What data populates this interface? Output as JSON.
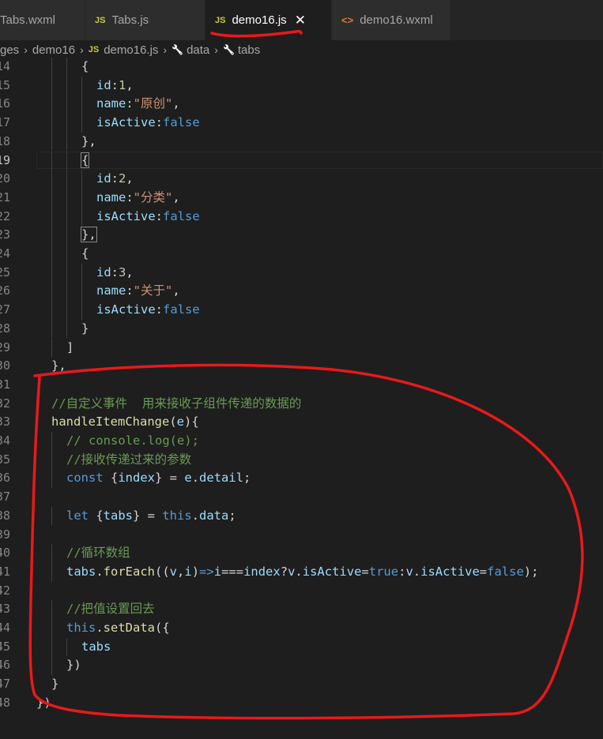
{
  "tabs": [
    {
      "label": "Tabs.wxml",
      "icon": "xml-file-icon",
      "active": false
    },
    {
      "label": "Tabs.js",
      "icon": "js-file-icon",
      "active": false
    },
    {
      "label": "demo16.js",
      "icon": "js-file-icon",
      "active": true,
      "close": "✕"
    },
    {
      "label": "demo16.wxml",
      "icon": "xml-file-icon",
      "active": false
    }
  ],
  "breadcrumb": [
    "ges",
    "demo16",
    "demo16.js",
    "data",
    "tabs"
  ],
  "editor": {
    "current_line": 19,
    "lines": [
      {
        "n": "14",
        "indent": 3,
        "tokens": [
          [
            "{",
            "pun"
          ]
        ]
      },
      {
        "n": "15",
        "indent": 4,
        "tokens": [
          [
            "id",
            "prop"
          ],
          [
            ":",
            "pun"
          ],
          [
            "1",
            "num"
          ],
          [
            ",",
            "pun"
          ]
        ]
      },
      {
        "n": "16",
        "indent": 4,
        "tokens": [
          [
            "name",
            "prop"
          ],
          [
            ":",
            "pun"
          ],
          [
            "\"原创\"",
            "str"
          ],
          [
            ",",
            "pun"
          ]
        ]
      },
      {
        "n": "17",
        "indent": 4,
        "tokens": [
          [
            "isActive",
            "prop"
          ],
          [
            ":",
            "pun"
          ],
          [
            "false",
            "kw"
          ]
        ]
      },
      {
        "n": "18",
        "indent": 3,
        "tokens": [
          [
            "},",
            "pun"
          ]
        ]
      },
      {
        "n": "19",
        "indent": 3,
        "tokens": [
          [
            "{",
            "pun"
          ]
        ]
      },
      {
        "n": "20",
        "indent": 4,
        "tokens": [
          [
            "id",
            "prop"
          ],
          [
            ":",
            "pun"
          ],
          [
            "2",
            "num"
          ],
          [
            ",",
            "pun"
          ]
        ]
      },
      {
        "n": "21",
        "indent": 4,
        "tokens": [
          [
            "name",
            "prop"
          ],
          [
            ":",
            "pun"
          ],
          [
            "\"分类\"",
            "str"
          ],
          [
            ",",
            "pun"
          ]
        ]
      },
      {
        "n": "22",
        "indent": 4,
        "tokens": [
          [
            "isActive",
            "prop"
          ],
          [
            ":",
            "pun"
          ],
          [
            "false",
            "kw"
          ]
        ]
      },
      {
        "n": "23",
        "indent": 3,
        "tokens": [
          [
            "},",
            "pun"
          ]
        ]
      },
      {
        "n": "24",
        "indent": 3,
        "tokens": [
          [
            "{",
            "pun"
          ]
        ]
      },
      {
        "n": "25",
        "indent": 4,
        "tokens": [
          [
            "id",
            "prop"
          ],
          [
            ":",
            "pun"
          ],
          [
            "3",
            "num"
          ],
          [
            ",",
            "pun"
          ]
        ]
      },
      {
        "n": "26",
        "indent": 4,
        "tokens": [
          [
            "name",
            "prop"
          ],
          [
            ":",
            "pun"
          ],
          [
            "\"关于\"",
            "str"
          ],
          [
            ",",
            "pun"
          ]
        ]
      },
      {
        "n": "27",
        "indent": 4,
        "tokens": [
          [
            "isActive",
            "prop"
          ],
          [
            ":",
            "pun"
          ],
          [
            "false",
            "kw"
          ]
        ]
      },
      {
        "n": "28",
        "indent": 3,
        "tokens": [
          [
            "}",
            "pun"
          ]
        ]
      },
      {
        "n": "29",
        "indent": 2,
        "tokens": [
          [
            "]",
            "pun"
          ]
        ]
      },
      {
        "n": "30",
        "indent": 1,
        "tokens": [
          [
            "},",
            "pun"
          ]
        ]
      },
      {
        "n": "31",
        "indent": 0,
        "tokens": []
      },
      {
        "n": "32",
        "indent": 1,
        "tokens": [
          [
            "//自定义事件  用来接收子组件传递的数据的",
            "com"
          ]
        ]
      },
      {
        "n": "33",
        "indent": 1,
        "tokens": [
          [
            "handleItemChange",
            "fn"
          ],
          [
            "(",
            "pun"
          ],
          [
            "e",
            "prop"
          ],
          [
            "){",
            "pun"
          ]
        ]
      },
      {
        "n": "34",
        "indent": 2,
        "tokens": [
          [
            "// console.log(e);",
            "com"
          ]
        ]
      },
      {
        "n": "35",
        "indent": 2,
        "tokens": [
          [
            "//接收传递过来的参数",
            "com"
          ]
        ]
      },
      {
        "n": "36",
        "indent": 2,
        "tokens": [
          [
            "const",
            "kw"
          ],
          [
            " {",
            "pun"
          ],
          [
            "index",
            "prop"
          ],
          [
            "} = ",
            "pun"
          ],
          [
            "e",
            "prop"
          ],
          [
            ".",
            "pun"
          ],
          [
            "detail",
            "prop"
          ],
          [
            ";",
            "pun"
          ]
        ]
      },
      {
        "n": "37",
        "indent": 0,
        "tokens": []
      },
      {
        "n": "38",
        "indent": 2,
        "tokens": [
          [
            "let",
            "kw"
          ],
          [
            " {",
            "pun"
          ],
          [
            "tabs",
            "prop"
          ],
          [
            "} = ",
            "pun"
          ],
          [
            "this",
            "kw"
          ],
          [
            ".",
            "pun"
          ],
          [
            "data",
            "prop"
          ],
          [
            ";",
            "pun"
          ]
        ]
      },
      {
        "n": "39",
        "indent": 0,
        "tokens": []
      },
      {
        "n": "40",
        "indent": 2,
        "tokens": [
          [
            "//循环数组",
            "com"
          ]
        ]
      },
      {
        "n": "41",
        "indent": 2,
        "tokens": [
          [
            "tabs",
            "prop"
          ],
          [
            ".",
            "pun"
          ],
          [
            "forEach",
            "fn"
          ],
          [
            "((",
            "pun"
          ],
          [
            "v",
            "prop"
          ],
          [
            ",",
            "pun"
          ],
          [
            "i",
            "prop"
          ],
          [
            ")",
            "pun"
          ],
          [
            "=>",
            "kw"
          ],
          [
            "i",
            "prop"
          ],
          [
            "===",
            "pun"
          ],
          [
            "index",
            "prop"
          ],
          [
            "?",
            "pun"
          ],
          [
            "v",
            "prop"
          ],
          [
            ".",
            "pun"
          ],
          [
            "isActive",
            "prop"
          ],
          [
            "=",
            "pun"
          ],
          [
            "true",
            "kw"
          ],
          [
            ":",
            "pun"
          ],
          [
            "v",
            "prop"
          ],
          [
            ".",
            "pun"
          ],
          [
            "isActive",
            "prop"
          ],
          [
            "=",
            "pun"
          ],
          [
            "false",
            "kw"
          ],
          [
            ");",
            "pun"
          ]
        ]
      },
      {
        "n": "42",
        "indent": 0,
        "tokens": []
      },
      {
        "n": "43",
        "indent": 2,
        "tokens": [
          [
            "//把值设置回去",
            "com"
          ]
        ]
      },
      {
        "n": "44",
        "indent": 2,
        "tokens": [
          [
            "this",
            "kw"
          ],
          [
            ".",
            "pun"
          ],
          [
            "setData",
            "fn"
          ],
          [
            "({",
            "pun"
          ]
        ]
      },
      {
        "n": "45",
        "indent": 3,
        "tokens": [
          [
            "tabs",
            "prop"
          ]
        ]
      },
      {
        "n": "46",
        "indent": 2,
        "tokens": [
          [
            "})",
            "pun"
          ]
        ]
      },
      {
        "n": "47",
        "indent": 1,
        "tokens": [
          [
            "}",
            "pun"
          ]
        ]
      },
      {
        "n": "48",
        "indent": 0,
        "tokens": [
          [
            "})",
            "pun"
          ]
        ]
      }
    ]
  },
  "colors": {
    "annotation_red": "#e8191c",
    "background": "#1e1e1e",
    "tab_bar": "#252526"
  }
}
